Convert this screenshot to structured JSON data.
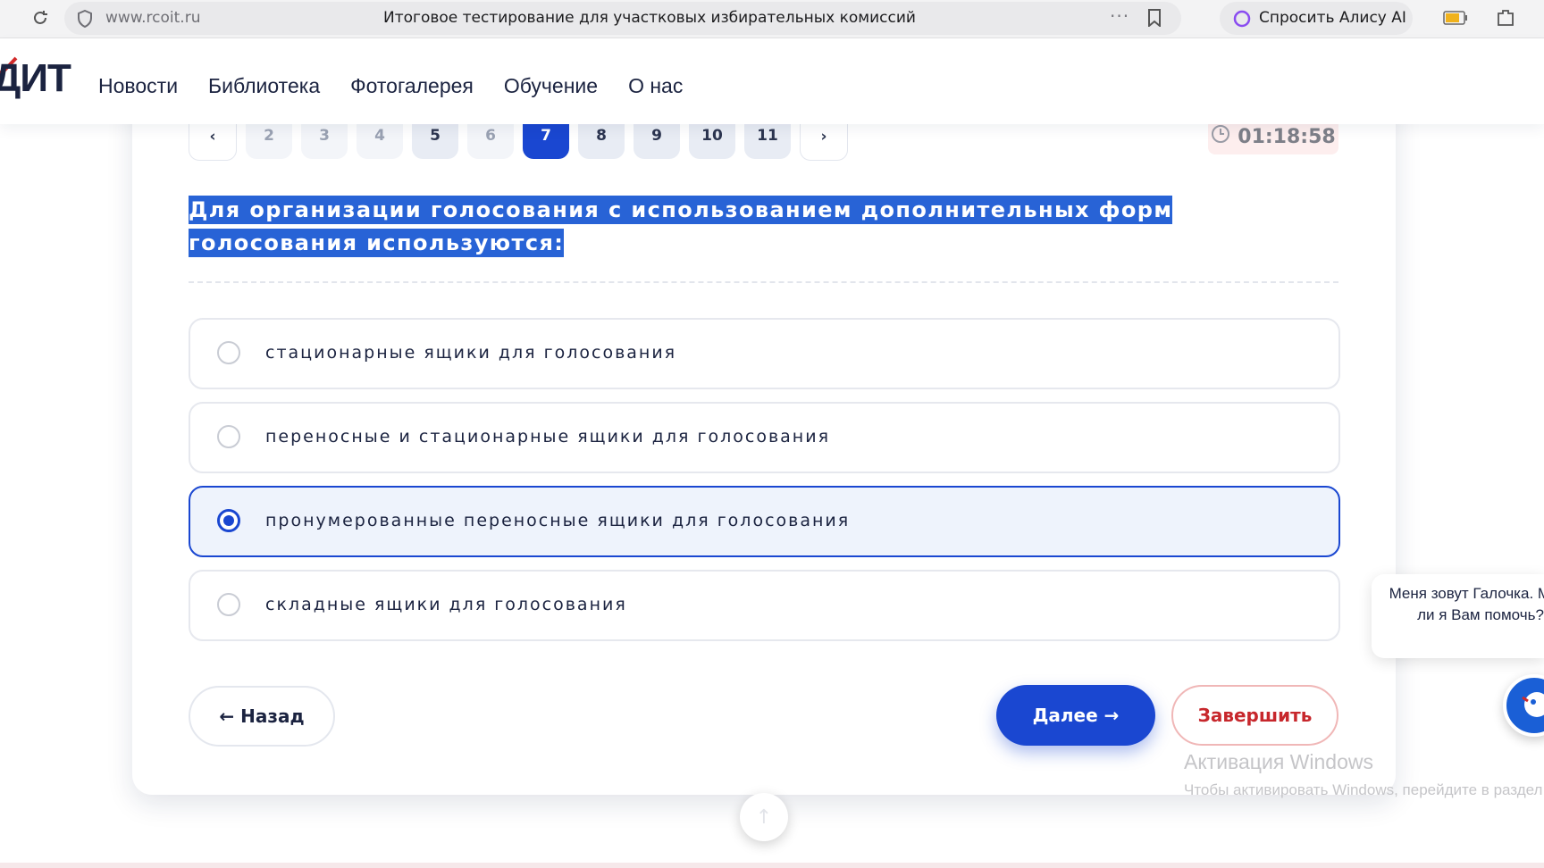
{
  "browser": {
    "url": "www.rcoit.ru",
    "tab_title": "Итоговое тестирование для участковых избирательных комиссий",
    "more_label": "···",
    "alisa_label": "Спросить Алису AI"
  },
  "site": {
    "logo": "ДИТ",
    "nav": [
      "Новости",
      "Библиотека",
      "Фотогалерея",
      "Обучение",
      "О нас"
    ]
  },
  "quiz": {
    "pager": {
      "prev": "‹",
      "next": "›",
      "pages": [
        "2",
        "3",
        "4",
        "5",
        "6",
        "7",
        "8",
        "9",
        "10",
        "11"
      ],
      "current": "7"
    },
    "timer": "01:18:58",
    "question": "Для организации голосования с использованием дополнительных форм голосования используются:",
    "options": [
      "стационарные ящики для голосования",
      "переносные и стационарные ящики для голосования",
      "пронумерованные переносные ящики для голосования",
      "складные ящики для голосования"
    ],
    "selected_index": 2,
    "back_label": "← Назад",
    "next_label": "Далее →",
    "finish_label": "Завершить"
  },
  "chat": {
    "bubble_text": "Меня зовут Галочка. Могу ли я Вам помочь?"
  },
  "watermark": {
    "title": "Активация Windows",
    "text": "Чтобы активировать Windows, перейдите в раздел \"Параметры\"."
  },
  "colors": {
    "accent": "#1a47d1",
    "selection": "#2863d6",
    "finish": "#c7272c"
  }
}
